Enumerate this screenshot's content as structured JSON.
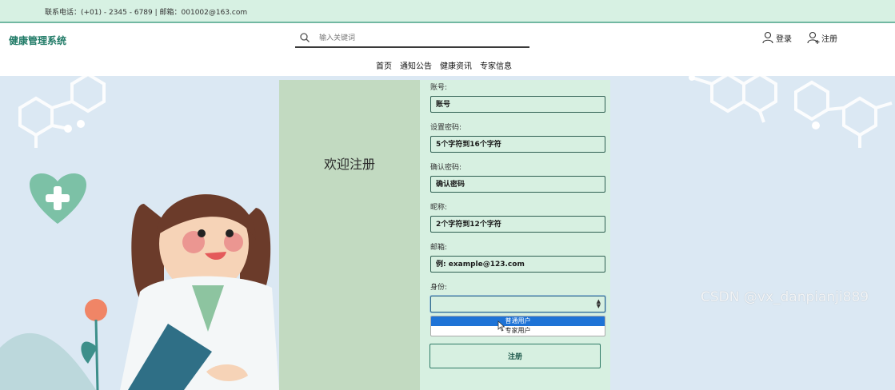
{
  "topbar": {
    "contact": "联系电话：(+01) - 2345 - 6789 | 邮箱：001002@163.com"
  },
  "header": {
    "brand": "健康管理系统",
    "search_placeholder": "输入关键词",
    "login_label": "登录",
    "register_label": "注册"
  },
  "nav": {
    "items": [
      "首页",
      "通知公告",
      "健康资讯",
      "专家信息"
    ]
  },
  "welcome": {
    "title": "欢迎注册"
  },
  "form": {
    "account": {
      "label": "账号:",
      "placeholder": "账号"
    },
    "password": {
      "label": "设置密码:",
      "placeholder": "5个字符到16个字符"
    },
    "confirm": {
      "label": "确认密码:",
      "placeholder": "确认密码"
    },
    "nickname": {
      "label": "昵称:",
      "placeholder": "2个字符到12个字符"
    },
    "email": {
      "label": "邮箱:",
      "placeholder": "例: example@123.com"
    },
    "identity": {
      "label": "身份:",
      "value": "",
      "options": [
        "普通用户",
        "专家用户"
      ],
      "highlighted_index": 0
    },
    "submit_label": "注册"
  },
  "watermark": "CSDN @vx_danpianji889",
  "colors": {
    "accent": "#1f7a66",
    "topbar_bg": "#d7f1e3",
    "form_bg": "#d7f0e1",
    "welcome_bg": "#c2dac1",
    "page_bg": "#dbe8f3",
    "option_highlight": "#1e73d6"
  }
}
